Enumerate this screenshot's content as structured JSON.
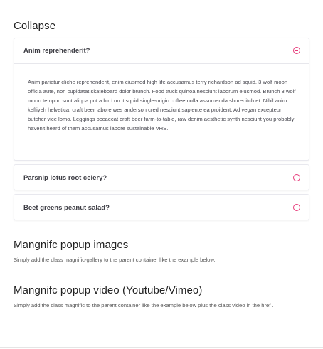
{
  "collapse": {
    "title": "Collapse",
    "items": [
      {
        "question": "Anim reprehenderit?",
        "icon": "minus-circle-icon",
        "expanded": true,
        "body": "Anim pariatur cliche reprehenderit, enim eiusmod high life accusamus terry richardson ad squid. 3 wolf moon officia aute, non cupidatat skateboard dolor brunch. Food truck quinoa nesciunt laborum eiusmod. Brunch 3 wolf moon tempor, sunt aliqua put a bird on it squid single-origin coffee nulla assumenda shoreditch et. Nihil anim keffiyeh helvetica, craft beer labore wes anderson cred nesciunt sapiente ea proident. Ad vegan excepteur butcher vice lomo. Leggings occaecat craft beer farm-to-table, raw denim aesthetic synth nesciunt you probably haven't heard of them accusamus labore sustainable VHS."
      },
      {
        "question": "Parsnip lotus root celery?",
        "icon": "info-circle-icon",
        "expanded": false
      },
      {
        "question": "Beet greens peanut salad?",
        "icon": "info-circle-icon",
        "expanded": false
      }
    ]
  },
  "popup_images": {
    "title": "Mangnifc popup images",
    "description": "Simply add the class magnific-gallery to the parent container like the example below."
  },
  "popup_video": {
    "title": "Mangnifc popup video (Youtube/Vimeo)",
    "description": "Simply add the class magnific to the parent container like the example below plus the class video in the href ."
  },
  "colors": {
    "accent": "#e73a7a",
    "card_border": "#e8e8ee",
    "text": "#333333"
  }
}
